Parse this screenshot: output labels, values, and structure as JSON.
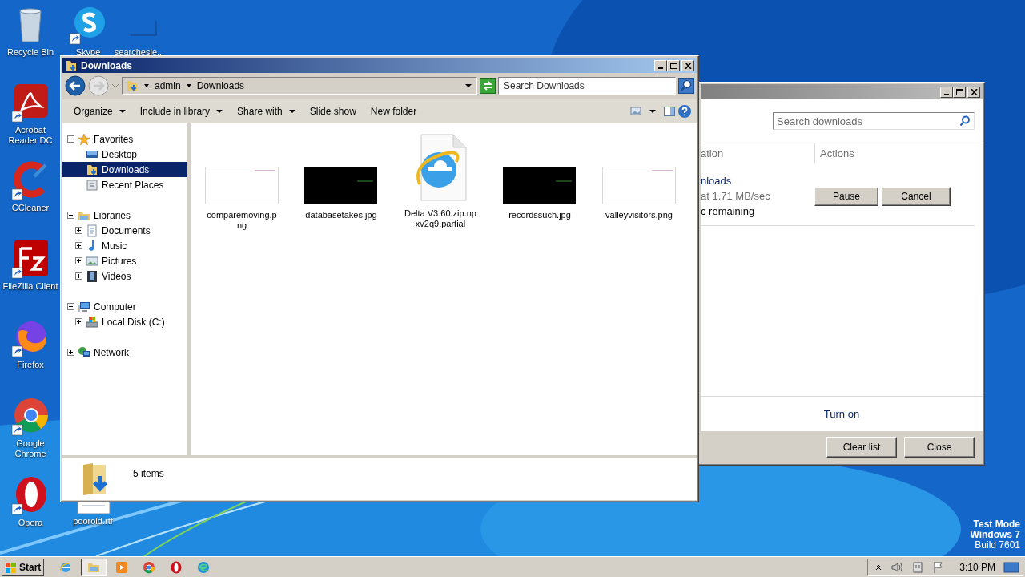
{
  "desktop_icons": [
    {
      "label": "Recycle Bin",
      "kind": "recycle",
      "shortcut": false
    },
    {
      "label": "Skype",
      "kind": "skype",
      "shortcut": true
    },
    {
      "label": "searchesje...",
      "kind": "blank",
      "shortcut": false
    },
    {
      "label": "Acrobat Reader DC",
      "kind": "acrobat",
      "shortcut": true
    },
    {
      "label": "CCleaner",
      "kind": "ccleaner",
      "shortcut": true
    },
    {
      "label": "FileZilla Client",
      "kind": "filezilla",
      "shortcut": true
    },
    {
      "label": "Firefox",
      "kind": "firefox",
      "shortcut": true
    },
    {
      "label": "Google Chrome",
      "kind": "chrome",
      "shortcut": true
    },
    {
      "label": "Opera",
      "kind": "opera",
      "shortcut": true
    },
    {
      "label": "poorold.rtf",
      "kind": "document",
      "shortcut": false
    }
  ],
  "explorer": {
    "title": "Downloads",
    "breadcrumb": [
      "admin",
      "Downloads"
    ],
    "search": {
      "placeholder": "Search Downloads"
    },
    "toolbar": [
      {
        "label": "Organize",
        "dropdown": true
      },
      {
        "label": "Include in library",
        "dropdown": true
      },
      {
        "label": "Share with",
        "dropdown": true
      },
      {
        "label": "Slide show",
        "dropdown": false
      },
      {
        "label": "New folder",
        "dropdown": false
      }
    ],
    "nav": [
      {
        "label": "Favorites",
        "expanded": true,
        "selected": false,
        "children": [
          {
            "label": "Desktop",
            "selected": false
          },
          {
            "label": "Downloads",
            "selected": true
          },
          {
            "label": "Recent Places",
            "selected": false
          }
        ]
      },
      {
        "label": "Libraries",
        "expanded": true,
        "selected": false,
        "children": [
          {
            "label": "Documents",
            "expanded": false,
            "selected": false
          },
          {
            "label": "Music",
            "expanded": false,
            "selected": false
          },
          {
            "label": "Pictures",
            "expanded": false,
            "selected": false
          },
          {
            "label": "Videos",
            "expanded": false,
            "selected": false
          }
        ]
      },
      {
        "label": "Computer",
        "expanded": true,
        "selected": false,
        "children": [
          {
            "label": "Local Disk (C:)",
            "expanded": false,
            "selected": false
          }
        ]
      },
      {
        "label": "Network",
        "expanded": false,
        "selected": false
      }
    ],
    "files": [
      {
        "name": "comparemoving.png",
        "kind": "white-thumb"
      },
      {
        "name": "databasetakes.jpg",
        "kind": "black-thumb"
      },
      {
        "name": "Delta V3.60.zip.npxv2q9.partial",
        "kind": "ie-file"
      },
      {
        "name": "recordssuch.jpg",
        "kind": "black-thumb"
      },
      {
        "name": "valleyvisitors.png",
        "kind": "white-thumb"
      }
    ],
    "status": "5 items"
  },
  "download_manager": {
    "search": {
      "placeholder": "Search downloads"
    },
    "columns": [
      "ation",
      "Actions"
    ],
    "download": {
      "name": "nloads",
      "speed": "at 1.71 MB/sec",
      "remaining": "c remaining",
      "actions": [
        "Pause",
        "Cancel"
      ]
    },
    "turn_on": "Turn on",
    "buttons": [
      "Clear list",
      "Close"
    ]
  },
  "os_notice": [
    "Test Mode",
    "Windows 7",
    "Build 7601"
  ],
  "taskbar": {
    "start": "Start",
    "apps": [
      {
        "kind": "ie",
        "selected": false
      },
      {
        "kind": "explorer",
        "selected": true
      },
      {
        "kind": "media",
        "selected": false
      },
      {
        "kind": "chrome",
        "selected": false
      },
      {
        "kind": "opera",
        "selected": false
      },
      {
        "kind": "edge",
        "selected": false
      }
    ],
    "time": "3:10 PM"
  }
}
